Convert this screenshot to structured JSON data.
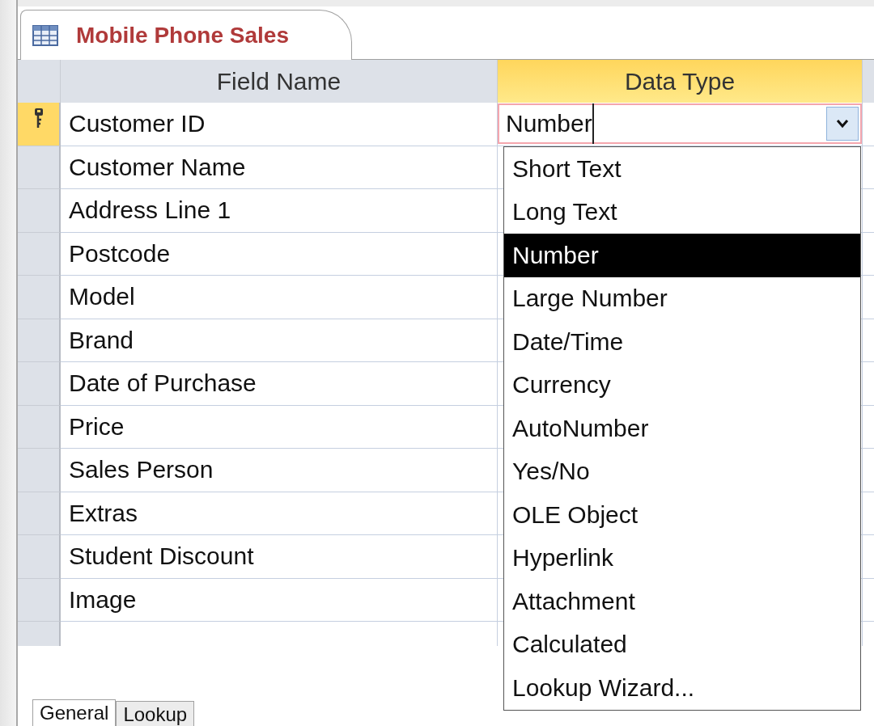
{
  "tab": {
    "title": "Mobile Phone Sales"
  },
  "columns": [
    {
      "label": "Field Name",
      "selected": false
    },
    {
      "label": "Data Type",
      "selected": true
    }
  ],
  "rows": [
    {
      "field_name": "Customer ID",
      "primary_key": true,
      "selected": true,
      "data_type": "Number"
    },
    {
      "field_name": "Customer Name",
      "primary_key": false,
      "selected": false
    },
    {
      "field_name": "Address Line 1",
      "primary_key": false,
      "selected": false
    },
    {
      "field_name": "Postcode",
      "primary_key": false,
      "selected": false
    },
    {
      "field_name": "Model",
      "primary_key": false,
      "selected": false
    },
    {
      "field_name": "Brand",
      "primary_key": false,
      "selected": false
    },
    {
      "field_name": "Date of Purchase",
      "primary_key": false,
      "selected": false
    },
    {
      "field_name": "Price",
      "primary_key": false,
      "selected": false
    },
    {
      "field_name": "Sales Person",
      "primary_key": false,
      "selected": false
    },
    {
      "field_name": "Extras",
      "primary_key": false,
      "selected": false
    },
    {
      "field_name": "Student Discount",
      "primary_key": false,
      "selected": false
    },
    {
      "field_name": "Image",
      "primary_key": false,
      "selected": false
    }
  ],
  "dropdown": {
    "options": [
      {
        "label": "Short Text",
        "selected": false
      },
      {
        "label": "Long Text",
        "selected": false
      },
      {
        "label": "Number",
        "selected": true
      },
      {
        "label": "Large Number",
        "selected": false
      },
      {
        "label": "Date/Time",
        "selected": false
      },
      {
        "label": "Currency",
        "selected": false
      },
      {
        "label": "AutoNumber",
        "selected": false
      },
      {
        "label": "Yes/No",
        "selected": false
      },
      {
        "label": "OLE Object",
        "selected": false
      },
      {
        "label": "Hyperlink",
        "selected": false
      },
      {
        "label": "Attachment",
        "selected": false
      },
      {
        "label": "Calculated",
        "selected": false
      },
      {
        "label": "Lookup Wizard...",
        "selected": false
      }
    ]
  },
  "bottom_tabs": [
    {
      "label": "General",
      "selected": true
    },
    {
      "label": "Lookup",
      "selected": false
    }
  ]
}
